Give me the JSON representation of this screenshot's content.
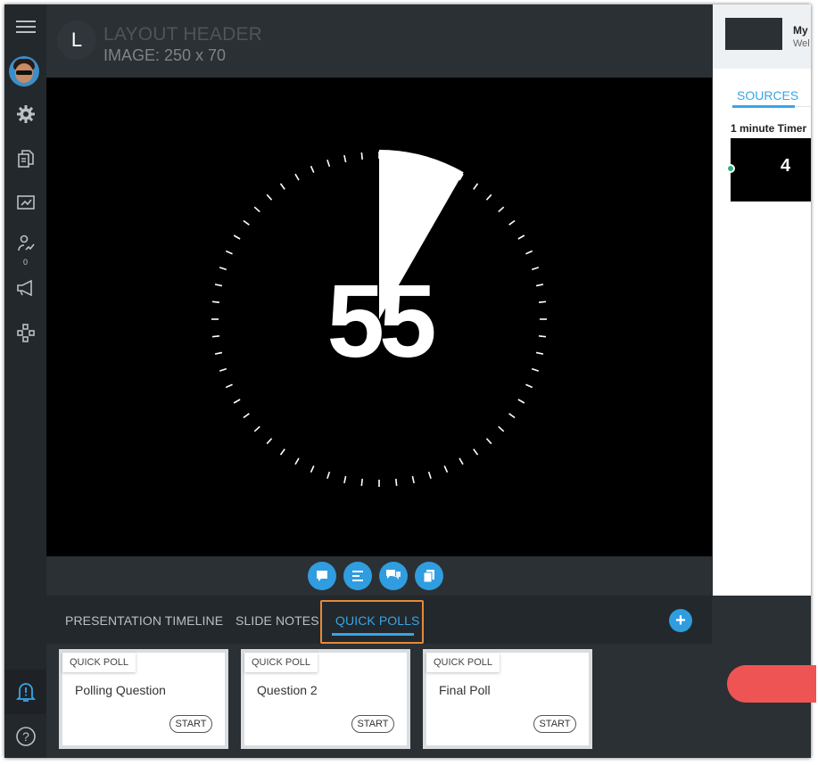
{
  "header": {
    "logo_letter": "L",
    "title": "LAYOUT HEADER",
    "subtitle": "IMAGE: 250 x 70"
  },
  "rail": {
    "icons": [
      "menu-icon",
      "avatar",
      "gear-icon",
      "documents-icon",
      "presentation-icon",
      "analytics-icon",
      "megaphone-icon",
      "network-icon",
      "alert-bell-icon",
      "help-icon"
    ],
    "analytics_count": "0",
    "help_label": "?"
  },
  "stage": {
    "timer_value": "55",
    "elapsed_fraction": 0.083,
    "tick_count": 60
  },
  "slide_controls": [
    "chat-icon",
    "list-icon",
    "qa-icon",
    "copy-icon"
  ],
  "tabs": {
    "items": [
      "PRESENTATION TIMELINE",
      "SLIDE NOTES",
      "QUICK POLLS"
    ],
    "active": "QUICK POLLS",
    "add_label": "+"
  },
  "polls": [
    {
      "tag": "QUICK POLL",
      "question": "Polling Question",
      "action": "START"
    },
    {
      "tag": "QUICK POLL",
      "question": "Question 2",
      "action": "START"
    },
    {
      "tag": "QUICK POLL",
      "question": "Final Poll",
      "action": "START"
    }
  ],
  "right_panel": {
    "name": "My",
    "subtitle": "Wel",
    "tab": "SOURCES",
    "source_title": "1 minute Timer",
    "source_value": "4"
  },
  "colors": {
    "accent": "#36a6e8",
    "button": "#2f9de0",
    "highlight": "#e4893a",
    "danger": "#ef5454",
    "online": "#2fb37a"
  }
}
